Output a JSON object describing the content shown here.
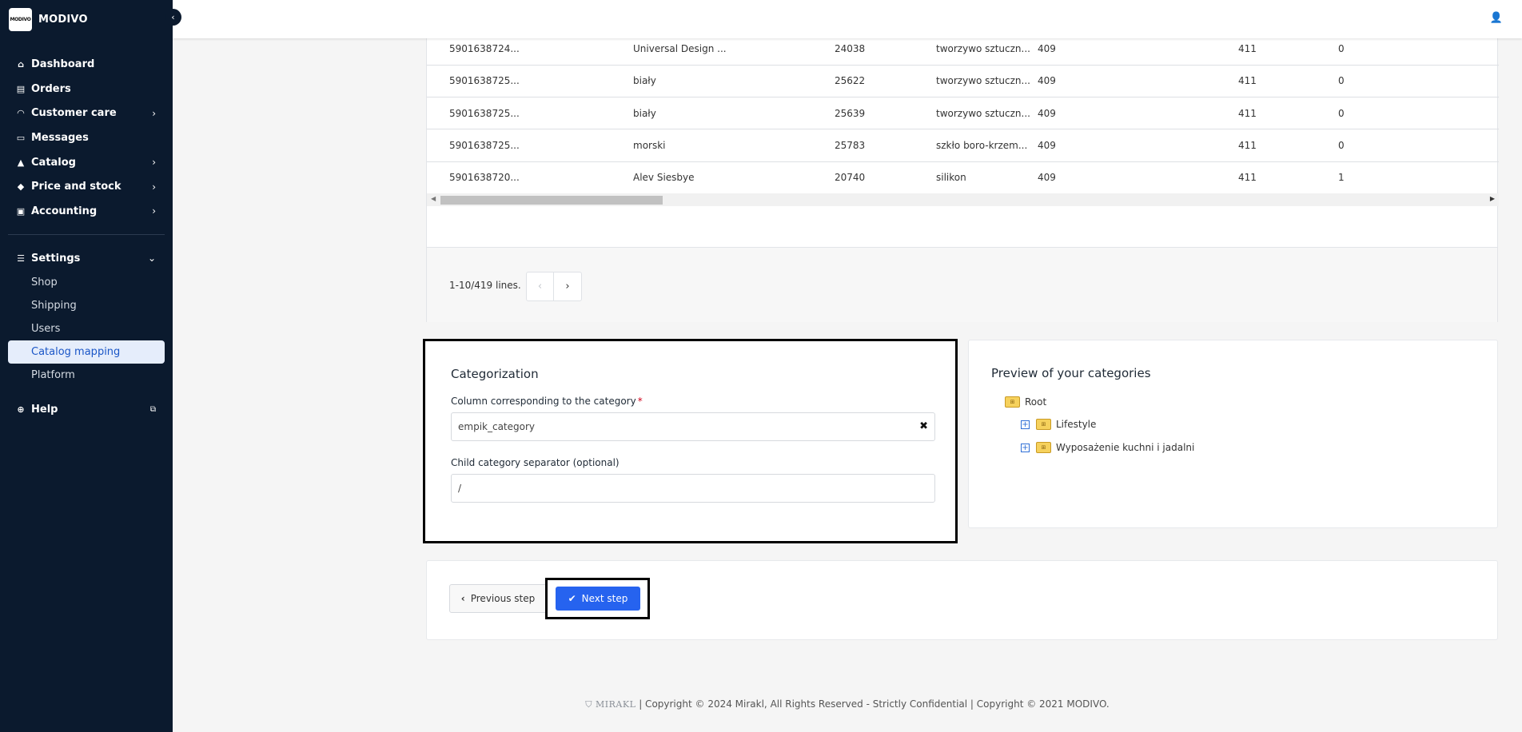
{
  "brand": {
    "logo_text": "MODIVO",
    "name": "MODIVO"
  },
  "nav": {
    "items": [
      {
        "label": "Dashboard",
        "icon": "home-icon"
      },
      {
        "label": "Orders",
        "icon": "orders-icon"
      },
      {
        "label": "Customer care",
        "icon": "headset-icon"
      },
      {
        "label": "Messages",
        "icon": "message-icon"
      },
      {
        "label": "Catalog",
        "icon": "shapes-icon"
      },
      {
        "label": "Price and stock",
        "icon": "tag-icon"
      },
      {
        "label": "Accounting",
        "icon": "invoice-icon"
      }
    ],
    "settings": {
      "label": "Settings",
      "icon": "sliders-icon"
    },
    "settings_sub": [
      "Shop",
      "Shipping",
      "Users",
      "Catalog mapping",
      "Platform"
    ],
    "help": {
      "label": "Help",
      "icon": "lifebuoy-icon"
    }
  },
  "table": {
    "rows": [
      [
        "5901638724...",
        "Universal Design ...",
        "24038",
        "tworzywo sztuczn...",
        "409",
        "411",
        "0"
      ],
      [
        "5901638725...",
        "biały",
        "25622",
        "tworzywo sztuczn...",
        "409",
        "411",
        "0"
      ],
      [
        "5901638725...",
        "biały",
        "25639",
        "tworzywo sztuczn...",
        "409",
        "411",
        "0"
      ],
      [
        "5901638725...",
        "morski",
        "25783",
        "szkło boro-krzem...",
        "409",
        "411",
        "0"
      ],
      [
        "5901638720...",
        "Alev Siesbye",
        "20740",
        "silikon",
        "409",
        "411",
        "1"
      ]
    ],
    "pager_text": "1-10/419 lines."
  },
  "categorization": {
    "title": "Categorization",
    "column_label": "Column corresponding to the category",
    "required_mark": "*",
    "column_value": "empik_category",
    "separator_label": "Child category separator (optional)",
    "separator_value": "/"
  },
  "preview": {
    "title": "Preview of your categories",
    "root": "Root",
    "children": [
      "Lifestyle",
      "Wyposażenie kuchni i jadalni"
    ]
  },
  "actions": {
    "previous_label": "Previous step",
    "next_label": "Next step",
    "primary_color": "#2663ef"
  },
  "footer": {
    "logo": "MIRAKL",
    "text": "| Copyright © 2024 Mirakl, All Rights Reserved - Strictly Confidential | Copyright © 2021 MODIVO."
  }
}
